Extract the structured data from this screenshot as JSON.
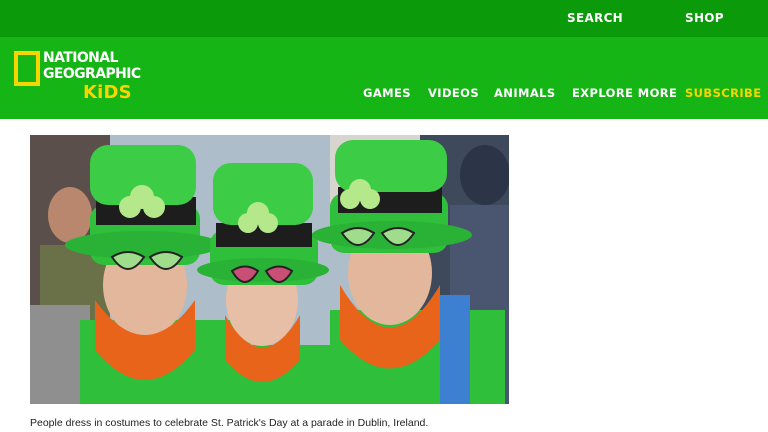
{
  "header": {
    "top_links": [
      "SEARCH",
      "SHOP"
    ],
    "logo": {
      "line1": "NATIONAL",
      "line2": "GEOGRAPHIC",
      "kids": "KiDS"
    },
    "nav": [
      "GAMES",
      "VIDEOS",
      "ANIMALS",
      "EXPLORE MORE",
      "SUBSCRIBE"
    ]
  },
  "article": {
    "image_alt": "",
    "caption": "People dress in costumes to celebrate St. Patrick's Day at a parade in Dublin, Ireland."
  },
  "colors": {
    "top_bar": "#0a9a0a",
    "nav_bar": "#14b514",
    "logo_yellow": "#f6d500",
    "costume_green": "#2fbf3a",
    "beard_orange": "#e8641a"
  }
}
